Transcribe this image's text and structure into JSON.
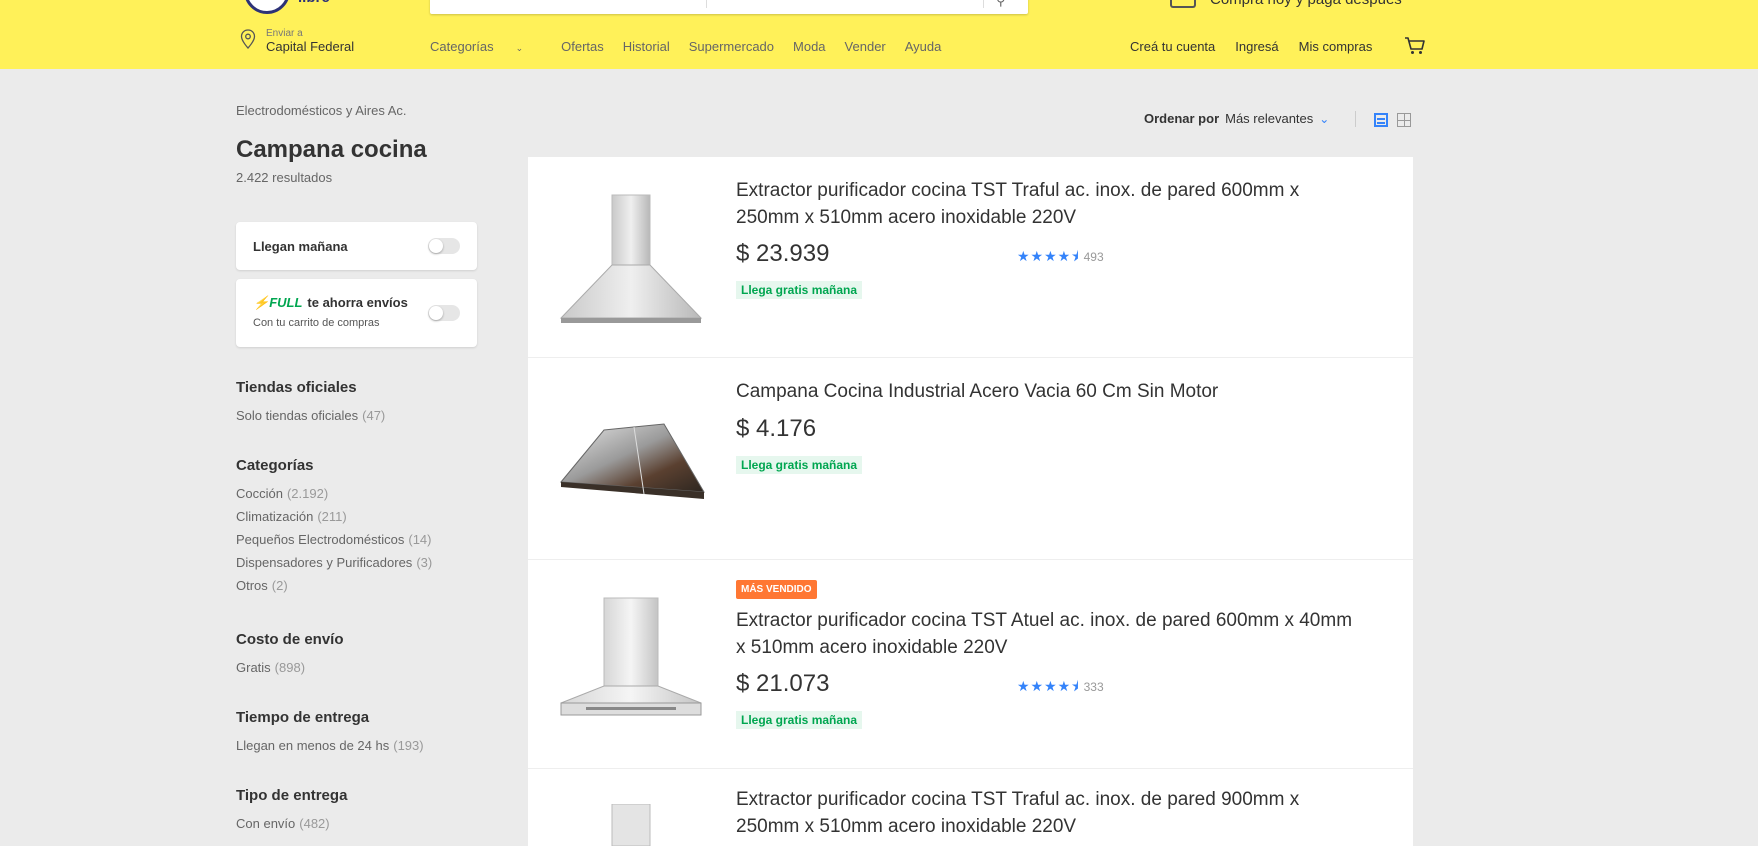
{
  "header": {
    "logo_text": "libre",
    "promo": "Comprá hoy y pagá después",
    "location_prefix": "Enviar a",
    "location": "Capital Federal",
    "nav": [
      "Categorías",
      "Ofertas",
      "Historial",
      "Supermercado",
      "Moda",
      "Vender",
      "Ayuda"
    ],
    "account": [
      "Creá tu cuenta",
      "Ingresá",
      "Mis compras"
    ]
  },
  "sidebar": {
    "breadcrumb": "Electrodomésticos y Aires Ac.",
    "title": "Campana cocina",
    "results": "2.422 resultados",
    "toggle1_label": "Llegan mañana",
    "full_logo": "FULL",
    "toggle2_label": "te ahorra envíos",
    "toggle2_sub": "Con tu carrito de compras",
    "sections": [
      {
        "title": "Tiendas oficiales",
        "items": [
          {
            "label": "Solo tiendas oficiales",
            "count": "(47)"
          }
        ]
      },
      {
        "title": "Categorías",
        "items": [
          {
            "label": "Cocción",
            "count": "(2.192)"
          },
          {
            "label": "Climatización",
            "count": "(211)"
          },
          {
            "label": "Pequeños Electrodomésticos",
            "count": "(14)"
          },
          {
            "label": "Dispensadores y Purificadores",
            "count": "(3)"
          },
          {
            "label": "Otros",
            "count": "(2)"
          }
        ]
      },
      {
        "title": "Costo de envío",
        "items": [
          {
            "label": "Gratis",
            "count": "(898)"
          }
        ]
      },
      {
        "title": "Tiempo de entrega",
        "items": [
          {
            "label": "Llegan en menos de 24 hs",
            "count": "(193)"
          }
        ]
      },
      {
        "title": "Tipo de entrega",
        "items": [
          {
            "label": "Con envío",
            "count": "(482)"
          }
        ]
      }
    ]
  },
  "sort": {
    "label": "Ordenar por",
    "value": "Más relevantes"
  },
  "results": [
    {
      "title": "Extractor purificador cocina TST Traful ac. inox. de pared 600mm x 250mm x 510mm acero inoxidable 220V",
      "price": "$ 23.939",
      "shipping": "Llega gratis mañana",
      "rating": 4.5,
      "reviews": "493",
      "badge": ""
    },
    {
      "title": "Campana Cocina Industrial Acero Vacia 60 Cm Sin Motor",
      "price": "$ 4.176",
      "shipping": "Llega gratis mañana",
      "rating": null,
      "reviews": "",
      "badge": ""
    },
    {
      "title": "Extractor purificador cocina TST Atuel ac. inox. de pared 600mm x 40mm x 510mm acero inoxidable 220V",
      "price": "$ 21.073",
      "shipping": "Llega gratis mañana",
      "rating": 4.5,
      "reviews": "333",
      "badge": "MÁS VENDIDO"
    },
    {
      "title": "Extractor purificador cocina TST Traful ac. inox. de pared 900mm x 250mm x 510mm acero inoxidable 220V",
      "price": "",
      "shipping": "",
      "rating": null,
      "reviews": "",
      "badge": ""
    }
  ],
  "colors": {
    "header_bg": "#fff159",
    "accent": "#3483fa",
    "shipping": "#00a650",
    "badge": "#ff7733"
  }
}
